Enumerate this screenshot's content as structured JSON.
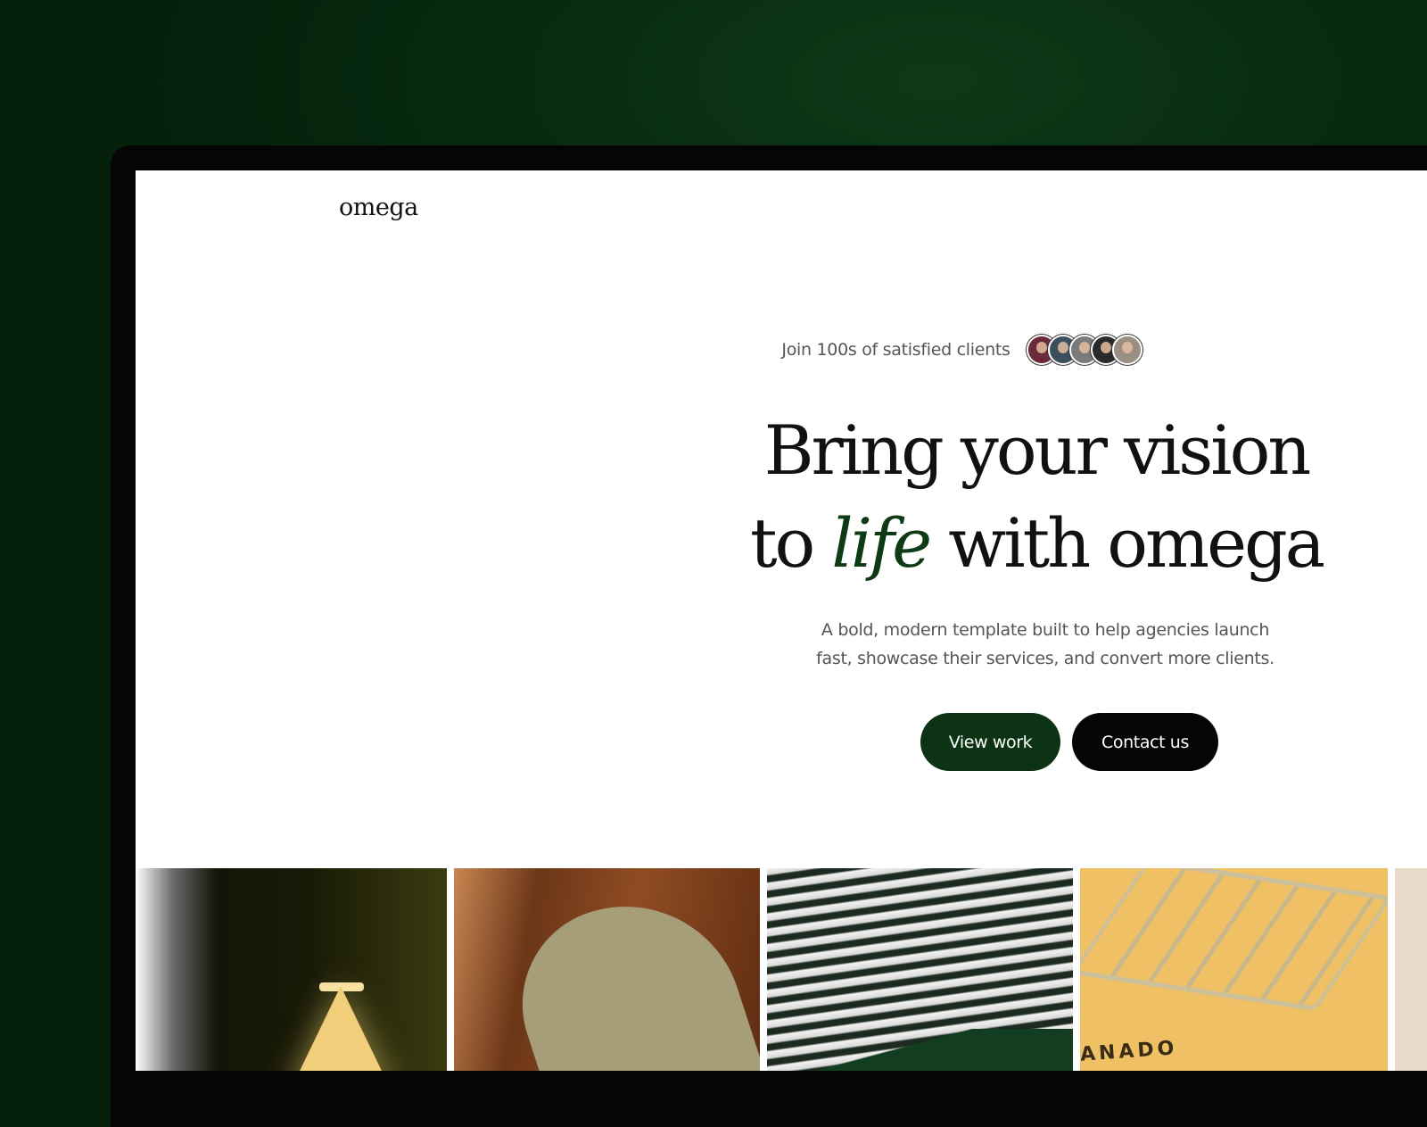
{
  "brand": {
    "logo": "omega"
  },
  "hero": {
    "social_proof": "Join 100s of satisfied clients",
    "avatars": [
      {
        "name": "client-avatar-1",
        "color": "#6b2b3a"
      },
      {
        "name": "client-avatar-2",
        "color": "#3c4f5c"
      },
      {
        "name": "client-avatar-3",
        "color": "#7a7a7a"
      },
      {
        "name": "client-avatar-4",
        "color": "#2a2a2a"
      },
      {
        "name": "client-avatar-5",
        "color": "#9a8f83"
      }
    ],
    "headline_line1": "Bring your vision",
    "headline_to": "to",
    "headline_accent": "life",
    "headline_rest": "with omega",
    "description": "A bold, modern template built to help agencies launch fast, showcase their services, and convert more clients.",
    "primary_cta": "View work",
    "secondary_cta": "Contact us"
  },
  "gallery": {
    "tiles": [
      {
        "name": "gallery-lamp-image"
      },
      {
        "name": "gallery-fabric-image"
      },
      {
        "name": "gallery-grille-image"
      },
      {
        "name": "gallery-roof-rack-image",
        "caption": "ANADO"
      },
      {
        "name": "gallery-partial-image"
      }
    ]
  },
  "colors": {
    "background": "#062a0f",
    "accent": "#0f3a16",
    "primary_button": "#0c3314",
    "secondary_button": "#050505"
  }
}
